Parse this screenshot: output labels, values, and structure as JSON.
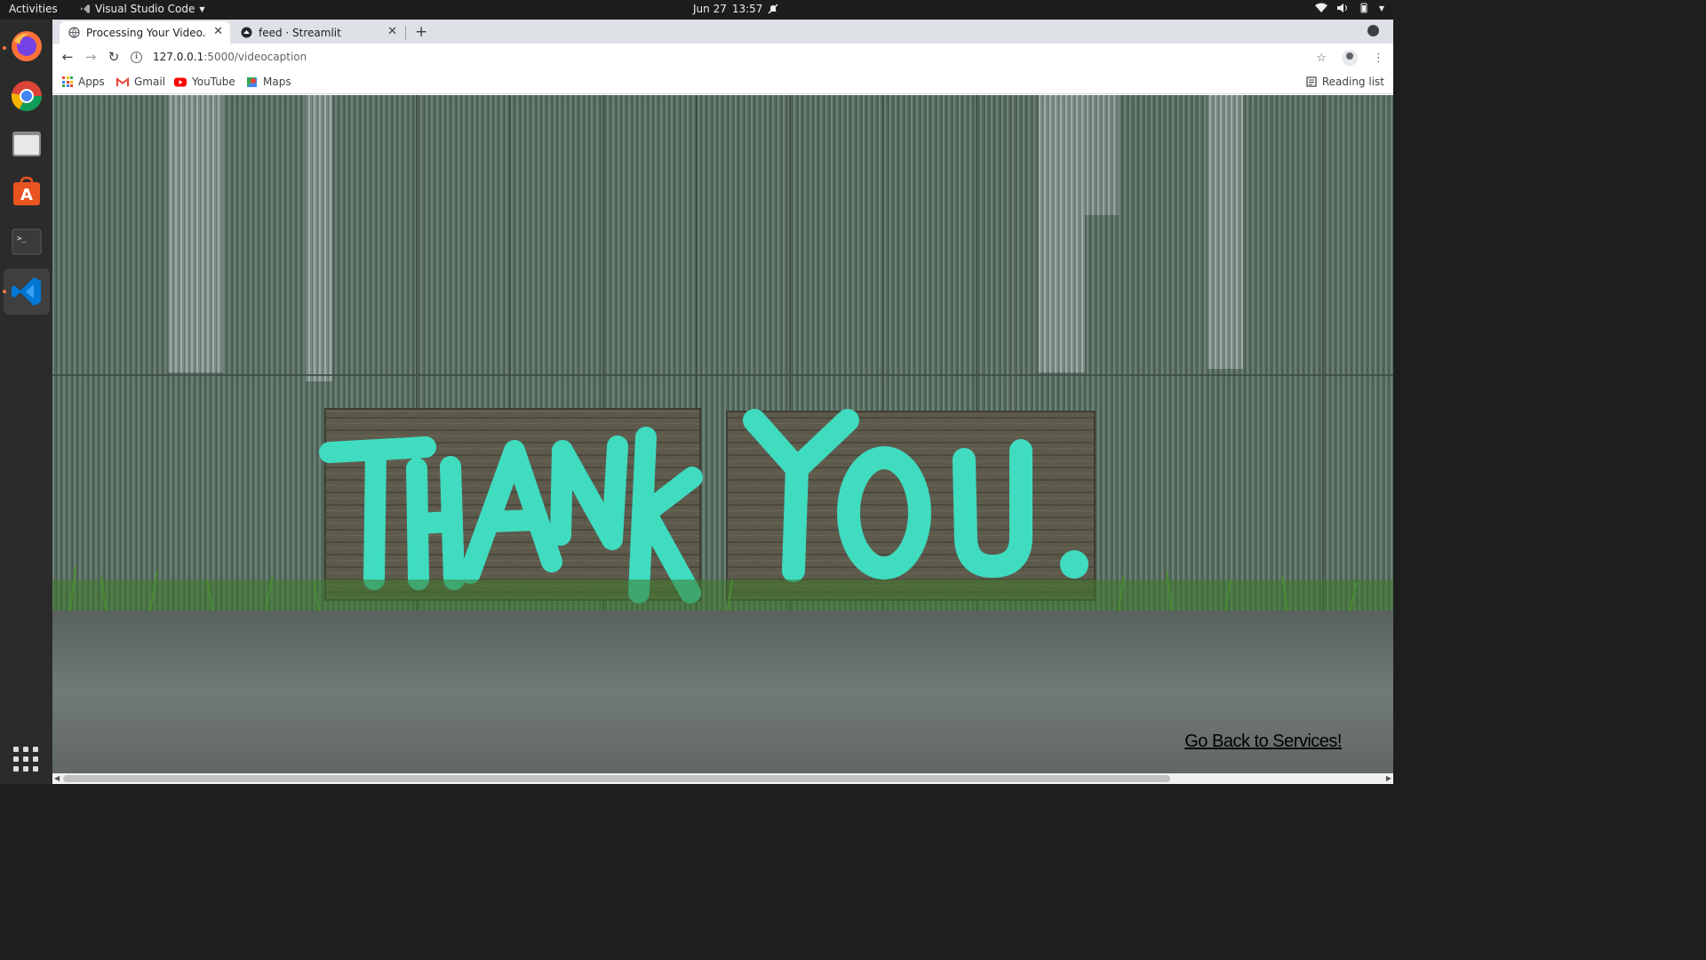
{
  "topbar": {
    "activities": "Activities",
    "app_name": "Visual Studio Code",
    "date": "Jun 27",
    "time": "13:57"
  },
  "dock": {
    "items": [
      "Firefox",
      "Google Chrome",
      "Files",
      "Ubuntu Software",
      "Terminal",
      "Visual Studio Code"
    ],
    "active": "Visual Studio Code"
  },
  "browser": {
    "tabs": [
      {
        "title": "Processing Your Video.",
        "active": true
      },
      {
        "title": "feed · Streamlit",
        "active": false
      }
    ],
    "url": {
      "host": "127.0.0.1",
      "path": ":5000/videocaption"
    },
    "bookmarks": [
      {
        "label": "Apps",
        "icon": "apps-grid-icon"
      },
      {
        "label": "Gmail",
        "icon": "gmail-icon"
      },
      {
        "label": "YouTube",
        "icon": "youtube-icon"
      },
      {
        "label": "Maps",
        "icon": "maps-icon"
      }
    ],
    "reading_list": "Reading list"
  },
  "page": {
    "photo_text": "THANK YOU.",
    "back_link": "Go Back to Services!"
  },
  "colors": {
    "paint": "#3fdcc0",
    "metal": "#5b7264",
    "wood": "#5d5a4c",
    "asphalt": "#6c7470",
    "grass": "#3e7a2a"
  }
}
